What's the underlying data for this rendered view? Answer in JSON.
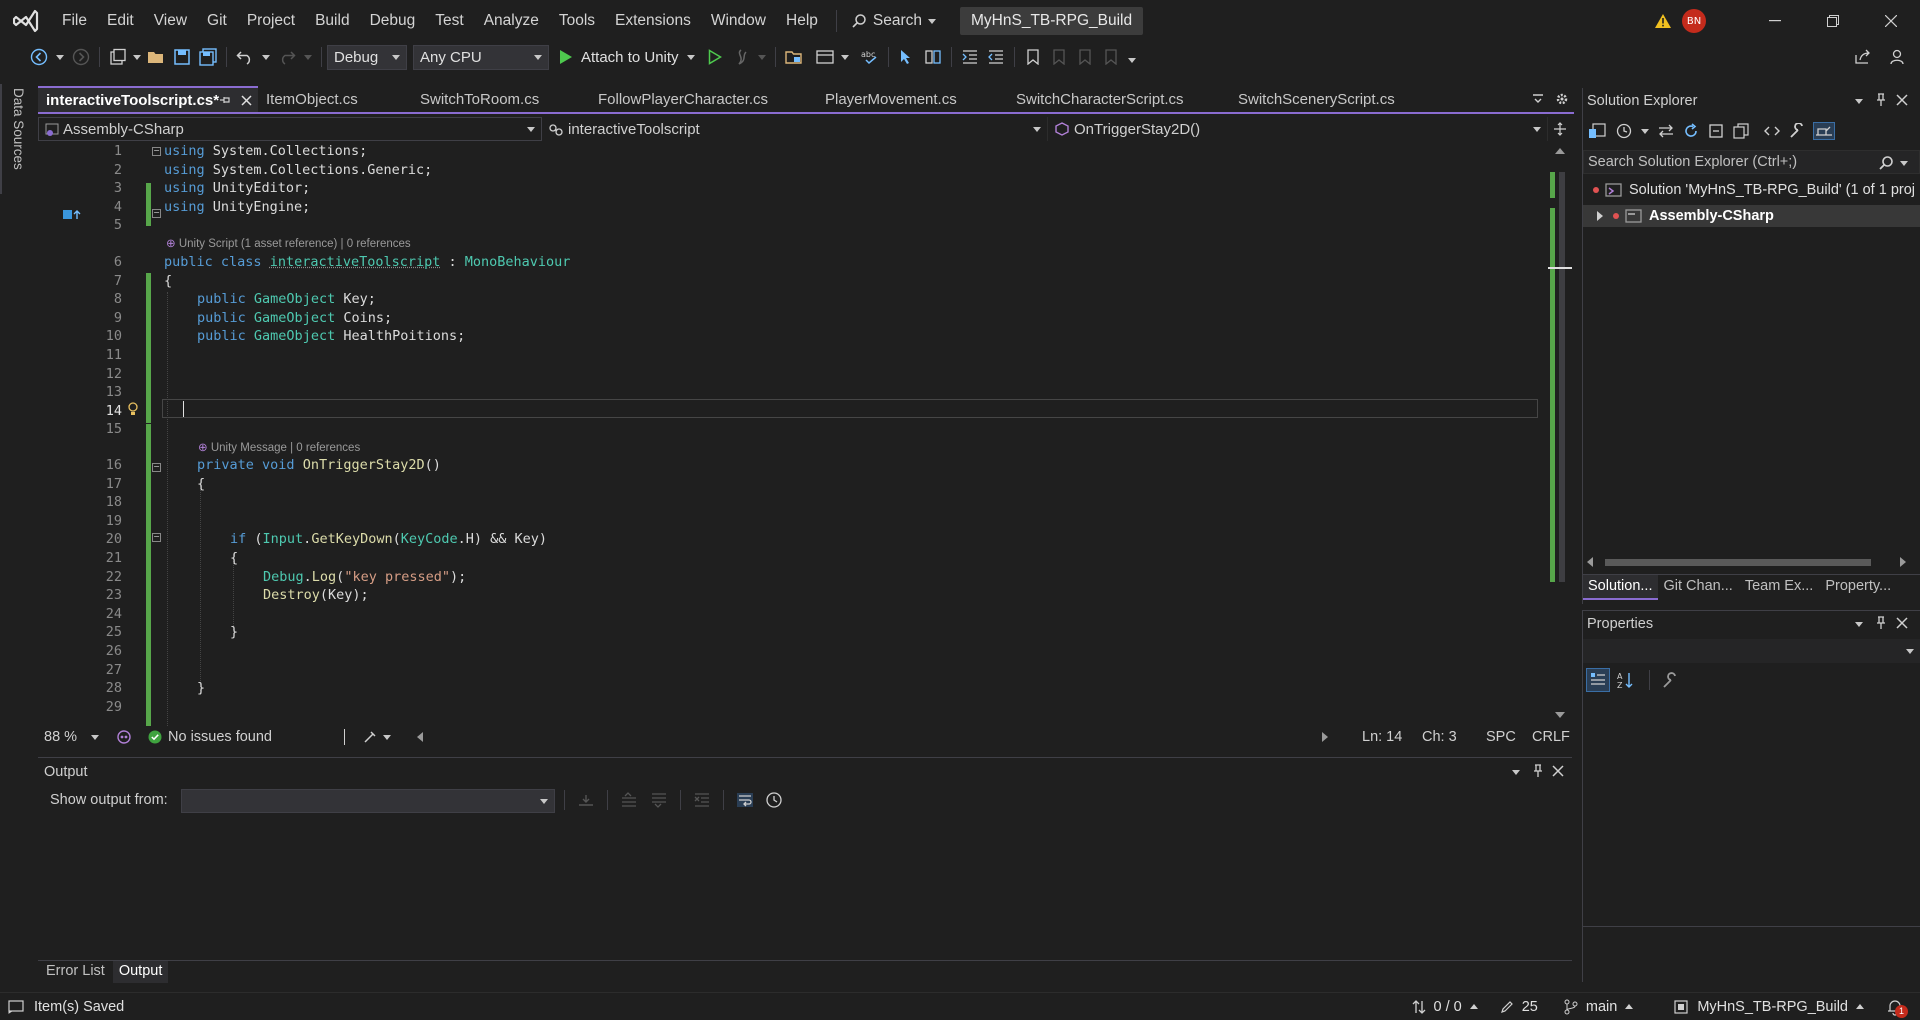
{
  "menu": [
    "File",
    "Edit",
    "View",
    "Git",
    "Project",
    "Build",
    "Debug",
    "Test",
    "Analyze",
    "Tools",
    "Extensions",
    "Window",
    "Help"
  ],
  "search_label": "Search",
  "solution_name": "MyHnS_TB-RPG_Build",
  "user_initials": "BN",
  "toolbar": {
    "config": "Debug",
    "platform": "Any CPU",
    "attach": "Attach to Unity"
  },
  "side_tab": "Data Sources",
  "tabs": [
    "interactiveToolscript.cs*",
    "ItemObject.cs",
    "SwitchToRoom.cs",
    "FollowPlayerCharacter.cs",
    "PlayerMovement.cs",
    "SwitchCharacterScript.cs",
    "SwitchSceneryScript.cs"
  ],
  "nav": {
    "project": "Assembly-CSharp",
    "class": "interactiveToolscript",
    "member": "OnTriggerStay2D()"
  },
  "codelens": {
    "class": "Unity Script (1 asset reference) | 0 references",
    "method": "Unity Message | 0 references"
  },
  "line_numbers": [
    "1",
    "2",
    "3",
    "4",
    "5",
    "6",
    "7",
    "8",
    "9",
    "10",
    "11",
    "12",
    "13",
    "14",
    "15",
    "16",
    "17",
    "18",
    "19",
    "20",
    "21",
    "22",
    "23",
    "24",
    "25",
    "26",
    "27",
    "28",
    "29"
  ],
  "code": {
    "l1": [
      "using",
      " System.Collections;"
    ],
    "l2": [
      "using",
      " System.Collections.Generic;"
    ],
    "l3": [
      "using",
      " UnityEditor;"
    ],
    "l4": [
      "using",
      " UnityEngine;"
    ],
    "l6": [
      "public class",
      " ",
      "interactiveToolscript",
      " : ",
      "MonoBehaviour"
    ],
    "l7": "{",
    "l8": [
      "public",
      " ",
      "GameObject",
      " Key;"
    ],
    "l9": [
      "public",
      " ",
      "GameObject",
      " Coins;"
    ],
    "l10": [
      "public",
      " ",
      "GameObject",
      " HealthPoitions;"
    ],
    "l16": [
      "private void",
      " ",
      "OnTriggerStay2D",
      "()"
    ],
    "l17": "{",
    "l20": [
      "if",
      " (",
      "Input",
      ".",
      "GetKeyDown",
      "(",
      "KeyCode",
      ".H) && Key)"
    ],
    "l21": "{",
    "l22": [
      "Debug",
      ".",
      "Log",
      "(",
      "\"key pressed\"",
      ");"
    ],
    "l23": [
      "Destroy",
      "(Key);"
    ],
    "l25": "}",
    "l28": "}"
  },
  "editor_status": {
    "zoom": "88 %",
    "issues": "No issues found",
    "ln": "Ln: 14",
    "ch": "Ch: 3",
    "spc": "SPC",
    "crlf": "CRLF"
  },
  "output": {
    "title": "Output",
    "show_from": "Show output from:"
  },
  "bottom_tabs": [
    "Error List",
    "Output"
  ],
  "solution_explorer": {
    "title": "Solution Explorer",
    "search_placeholder": "Search Solution Explorer (Ctrl+;)",
    "solution": "Solution 'MyHnS_TB-RPG_Build' (1 of 1 proj",
    "project": "Assembly-CSharp",
    "tabs": [
      "Solution...",
      "Git Chan...",
      "Team Ex...",
      "Property..."
    ]
  },
  "properties": {
    "title": "Properties"
  },
  "statusbar": {
    "saved": "Item(s) Saved",
    "changes": "0 / 0",
    "edits": "25",
    "branch": "main",
    "repo": "MyHnS_TB-RPG_Build",
    "notifications": "1"
  },
  "colors": {
    "accent": "#8a6cd1",
    "green": "#57a64a",
    "keyword": "#569cd6",
    "type": "#4ec9b0",
    "string": "#d69d85",
    "method": "#dcdcaa",
    "badge": "#c42b1c"
  }
}
